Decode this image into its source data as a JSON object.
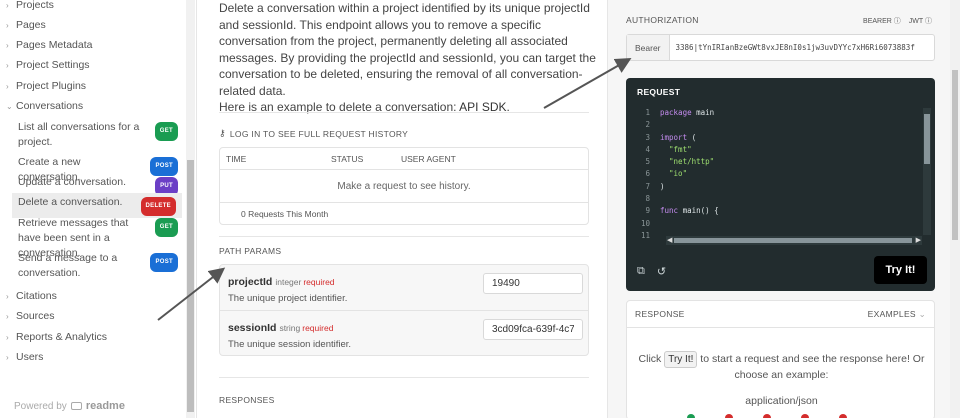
{
  "sidebar": {
    "top_items": [
      {
        "label": "Projects"
      },
      {
        "label": "Pages"
      },
      {
        "label": "Pages Metadata"
      },
      {
        "label": "Project Settings"
      },
      {
        "label": "Project Plugins"
      }
    ],
    "open_section": "Conversations",
    "sub_items": [
      {
        "label": "List all conversations for a project.",
        "method": "GET"
      },
      {
        "label": "Create a new conversation.",
        "method": "POST"
      },
      {
        "label": "Update a conversation.",
        "method": "PUT"
      },
      {
        "label": "Delete a conversation.",
        "method": "DELETE"
      },
      {
        "label": "Retrieve messages that have been sent in a conversation.",
        "method": "GET"
      },
      {
        "label": "Send a message to a conversation.",
        "method": "POST"
      }
    ],
    "bottom_items": [
      {
        "label": "Citations"
      },
      {
        "label": "Sources"
      },
      {
        "label": "Reports & Analytics"
      },
      {
        "label": "Users"
      }
    ],
    "powered_by": "Powered by",
    "brand": "readme"
  },
  "main": {
    "description": "Delete a conversation within a project identified by its unique projectId and sessionId. This endpoint allows you to remove a specific conversation from the project, permanently deleting all associated messages. By providing the projectId and sessionId, you can target the conversation to be deleted, ensuring the removal of all conversation-related data.",
    "example_text": "Here is an example to delete a conversation: ",
    "api_link": "API",
    "sdk_link": "SDK",
    "example_end": ".",
    "login_label": "LOG IN TO SEE FULL REQUEST HISTORY",
    "history": {
      "columns": [
        "TIME",
        "STATUS",
        "USER AGENT"
      ],
      "empty": "Make a request to see history.",
      "footer": "0 Requests This Month"
    },
    "path_params_title": "PATH PARAMS",
    "params": [
      {
        "name": "projectId",
        "type": "integer",
        "required": "required",
        "desc": "The unique project identifier.",
        "value": "19490"
      },
      {
        "name": "sessionId",
        "type": "string",
        "required": "required",
        "desc": "The unique session identifier.",
        "value": "3cd09fca-639f-4c7"
      }
    ],
    "responses_title": "RESPONSES"
  },
  "right": {
    "auth_title": "AUTHORIZATION",
    "auth_options": [
      "BEARER",
      "JWT"
    ],
    "bearer_label": "Bearer",
    "token": "3386|tYnIRIanBzeGWt8vxJE8nI0s1jw3uvDYYc7xH6Ri6073883f",
    "request_title": "REQUEST",
    "code_lines": [
      {
        "n": "1",
        "parts": [
          {
            "c": "kw",
            "t": "package "
          },
          {
            "c": "plain",
            "t": "main"
          }
        ]
      },
      {
        "n": "2",
        "parts": []
      },
      {
        "n": "3",
        "parts": [
          {
            "c": "kw",
            "t": "import "
          },
          {
            "c": "plain",
            "t": "("
          }
        ]
      },
      {
        "n": "4",
        "parts": [
          {
            "c": "str",
            "t": "  \"fmt\""
          }
        ]
      },
      {
        "n": "5",
        "parts": [
          {
            "c": "str",
            "t": "  \"net/http\""
          }
        ]
      },
      {
        "n": "6",
        "parts": [
          {
            "c": "str",
            "t": "  \"io\""
          }
        ]
      },
      {
        "n": "7",
        "parts": [
          {
            "c": "plain",
            "t": ")"
          }
        ]
      },
      {
        "n": "8",
        "parts": []
      },
      {
        "n": "9",
        "parts": [
          {
            "c": "kw",
            "t": "func "
          },
          {
            "c": "plain",
            "t": "main() {"
          }
        ]
      },
      {
        "n": "10",
        "parts": []
      },
      {
        "n": "11",
        "parts": []
      }
    ],
    "try_button": "Try It!",
    "response_title": "RESPONSE",
    "examples_label": "EXAMPLES",
    "response_hint_a": "Click ",
    "response_hint_btn": "Try It!",
    "response_hint_b": " to start a request and see the response here! Or choose an example:",
    "response_type": "application/json",
    "status_colors": [
      "#1a9c52",
      "#d42d2d",
      "#d42d2d",
      "#d42d2d",
      "#d42d2d"
    ]
  }
}
